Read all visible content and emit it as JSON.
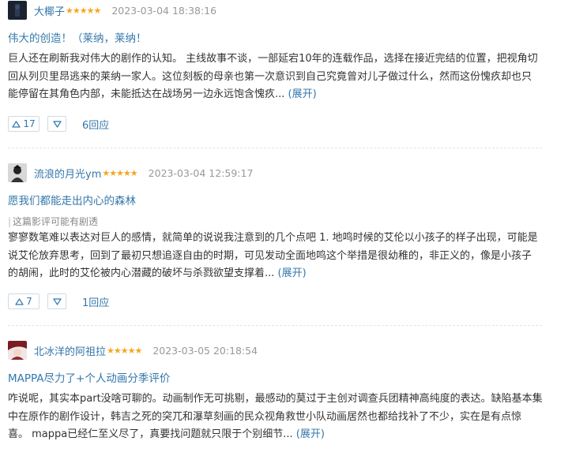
{
  "reviews": [
    {
      "username": "大椰子",
      "stars": "★★★★★",
      "time": "2023-03-04 18:38:16",
      "title": "伟大的创造！（莱纳，莱纳！",
      "spoiler": "",
      "lines": [
        "巨人还在刷新我对伟大的剧作的认知。 主线故事不谈，一部延宕10年的连载作品，选择在接近完结的位置，把视角切",
        "回从列贝里昂逃来的莱纳一家人。这位刻板的母亲也第一次意识到自己究竟曾对儿子做过什么，然而这份愧疚却也只",
        "能停留在其角色内部，未能抵达在战场另一边永远饱含愧疚..."
      ],
      "expand": "(展开)",
      "up": "17",
      "replies": "6回应"
    },
    {
      "username": "流浪的月光ym",
      "stars": "★★★★★",
      "time": "2023-03-04 12:59:17",
      "title": "愿我们都能走出内心的森林",
      "spoiler": "这篇影评可能有剧透",
      "lines": [
        "寥寥数笔难以表达对巨人的感情，就简单的说说我注意到的几个点吧 1. 地鸣时候的艾伦以小孩子的样子出现，可能是",
        "说艾伦放弃思考，回到了最初只想追逐自由的时期，可见发动全面地鸣这个举措是很幼稚的，非正义的，像是小孩子",
        "的胡闹，此时的艾伦被内心潜藏的破坏与杀戮欲望支撑着..."
      ],
      "expand": "(展开)",
      "up": "7",
      "replies": "1回应"
    },
    {
      "username": "北冰洋的阿祖拉",
      "stars": "★★★★★",
      "time": "2023-03-05 20:18:54",
      "title": "MAPPA尽力了+个人动画分季评价",
      "spoiler": "",
      "lines": [
        "咋说呢，其实本part没啥可聊的。动画制作无可挑剔，最感动的莫过于主创对调查兵团精神高纯度的表达。缺陷基本集",
        "中在原作的剧作设计，韩吉之死的突兀和瀑草刻画的民众视角救世小队动画居然也都给找补了不少，实在是有点惊",
        "喜。 mappa已经仁至义尽了，真要找问题就只限于个别细节..."
      ],
      "expand": "(展开)",
      "up": "",
      "replies": ""
    }
  ],
  "icons": {
    "up": "thumbs-up-triangle-icon",
    "down": "thumbs-down-triangle-icon"
  },
  "colors": {
    "link": "#3377aa",
    "star": "#f6a623",
    "meta": "#999999",
    "body": "#333333"
  }
}
